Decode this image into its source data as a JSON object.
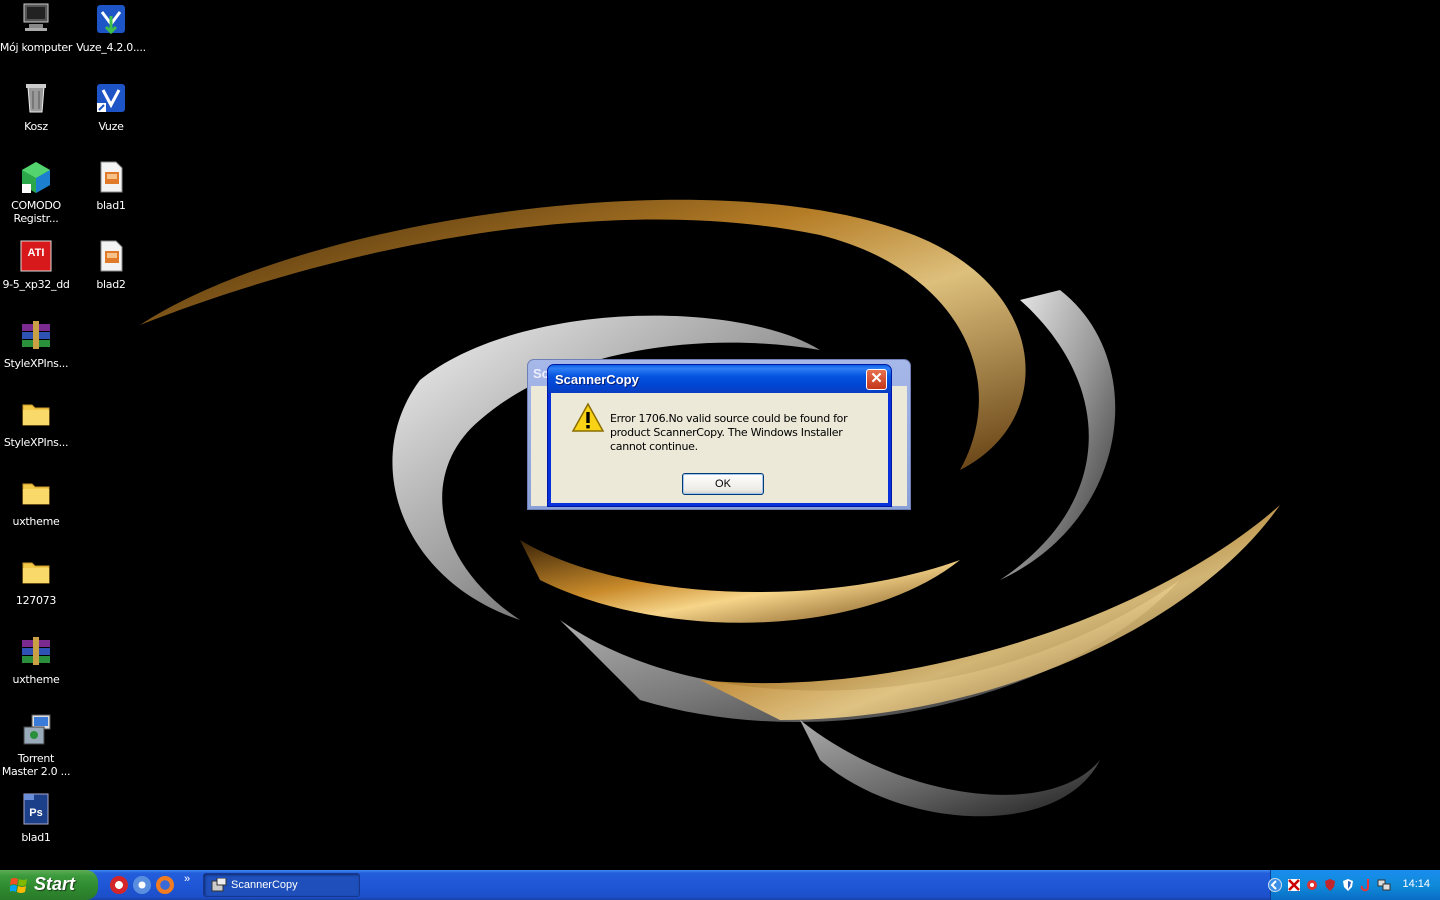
{
  "desktop": {
    "icons": [
      {
        "label": "Mój komputer"
      },
      {
        "label": "Vuze_4.2.0...."
      },
      {
        "label": "Kosz"
      },
      {
        "label": "Vuze"
      },
      {
        "label": "COMODO Registr..."
      },
      {
        "label": "blad1"
      },
      {
        "label": "9-5_xp32_dd"
      },
      {
        "label": "blad2"
      },
      {
        "label": "StyleXPIns..."
      },
      {
        "label": "StyleXPIns..."
      },
      {
        "label": "uxtheme"
      },
      {
        "label": "127073"
      },
      {
        "label": "uxtheme"
      },
      {
        "label": "Torrent Master 2.0 ..."
      },
      {
        "label": "blad1"
      }
    ]
  },
  "background_window": {
    "title": "Sc"
  },
  "dialog": {
    "title": "ScannerCopy",
    "close_glyph": "✕",
    "message": "Error 1706.No valid source could be found for product ScannerCopy.  The Windows Installer cannot continue.",
    "ok_label": "OK",
    "icon": "warning-icon"
  },
  "taskbar": {
    "start_label": "Start",
    "more_glyph": "»",
    "task_label": "ScannerCopy",
    "clock": "14:14"
  },
  "colors": {
    "titlebar": "#0054e3",
    "taskbar": "#245edb",
    "start": "#3c9a3c",
    "dialog_body": "#ece9d8"
  }
}
